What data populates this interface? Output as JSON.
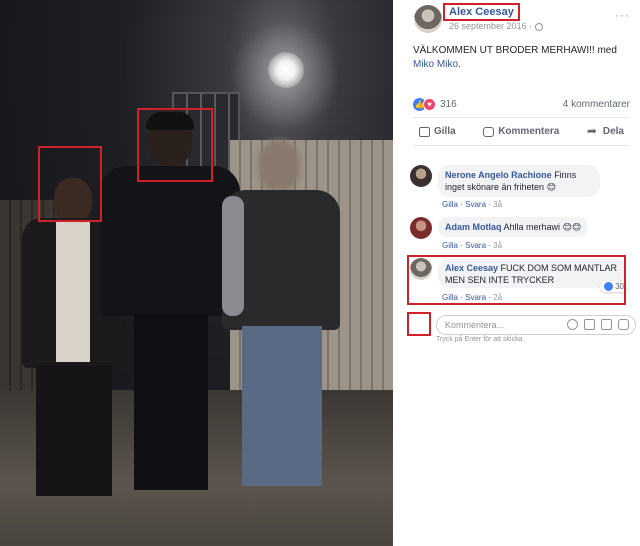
{
  "post": {
    "author": "Alex Ceesay",
    "date": "26 september 2016 ·",
    "text_main": "VÄLKOMMEN UT BRODER MERHAWI!!",
    "text_with": " med ",
    "tag": "Miko Miko",
    "text_end": ".",
    "reaction_count": "316",
    "comment_count": "4 kommentarer",
    "actions": {
      "like": "Gilla",
      "comment": "Kommentera",
      "share": "Dela"
    }
  },
  "comments": [
    {
      "author": "Nerone Angelo Rachione",
      "text": " Finns inget skönare än friheten 😊",
      "like": "Gilla",
      "reply": "Svara",
      "time": "3å"
    },
    {
      "author": "Adam Motlaq",
      "text": " Ahlla merhawi 😊😊",
      "like": "Gilla",
      "reply": "Svara",
      "time": "3å"
    },
    {
      "author": "Alex Ceesay",
      "text": " FUCK DOM SOM MANTLAR MEN SEN INTE TRYCKER",
      "like": "Gilla",
      "reply": "Svara",
      "time": "2å",
      "likes": "30"
    }
  ],
  "composer": {
    "placeholder": "Kommentera...",
    "hint": "Tryck på Enter för att skicka."
  },
  "colors": {
    "highlight": "#d0202a",
    "link": "#365899"
  }
}
